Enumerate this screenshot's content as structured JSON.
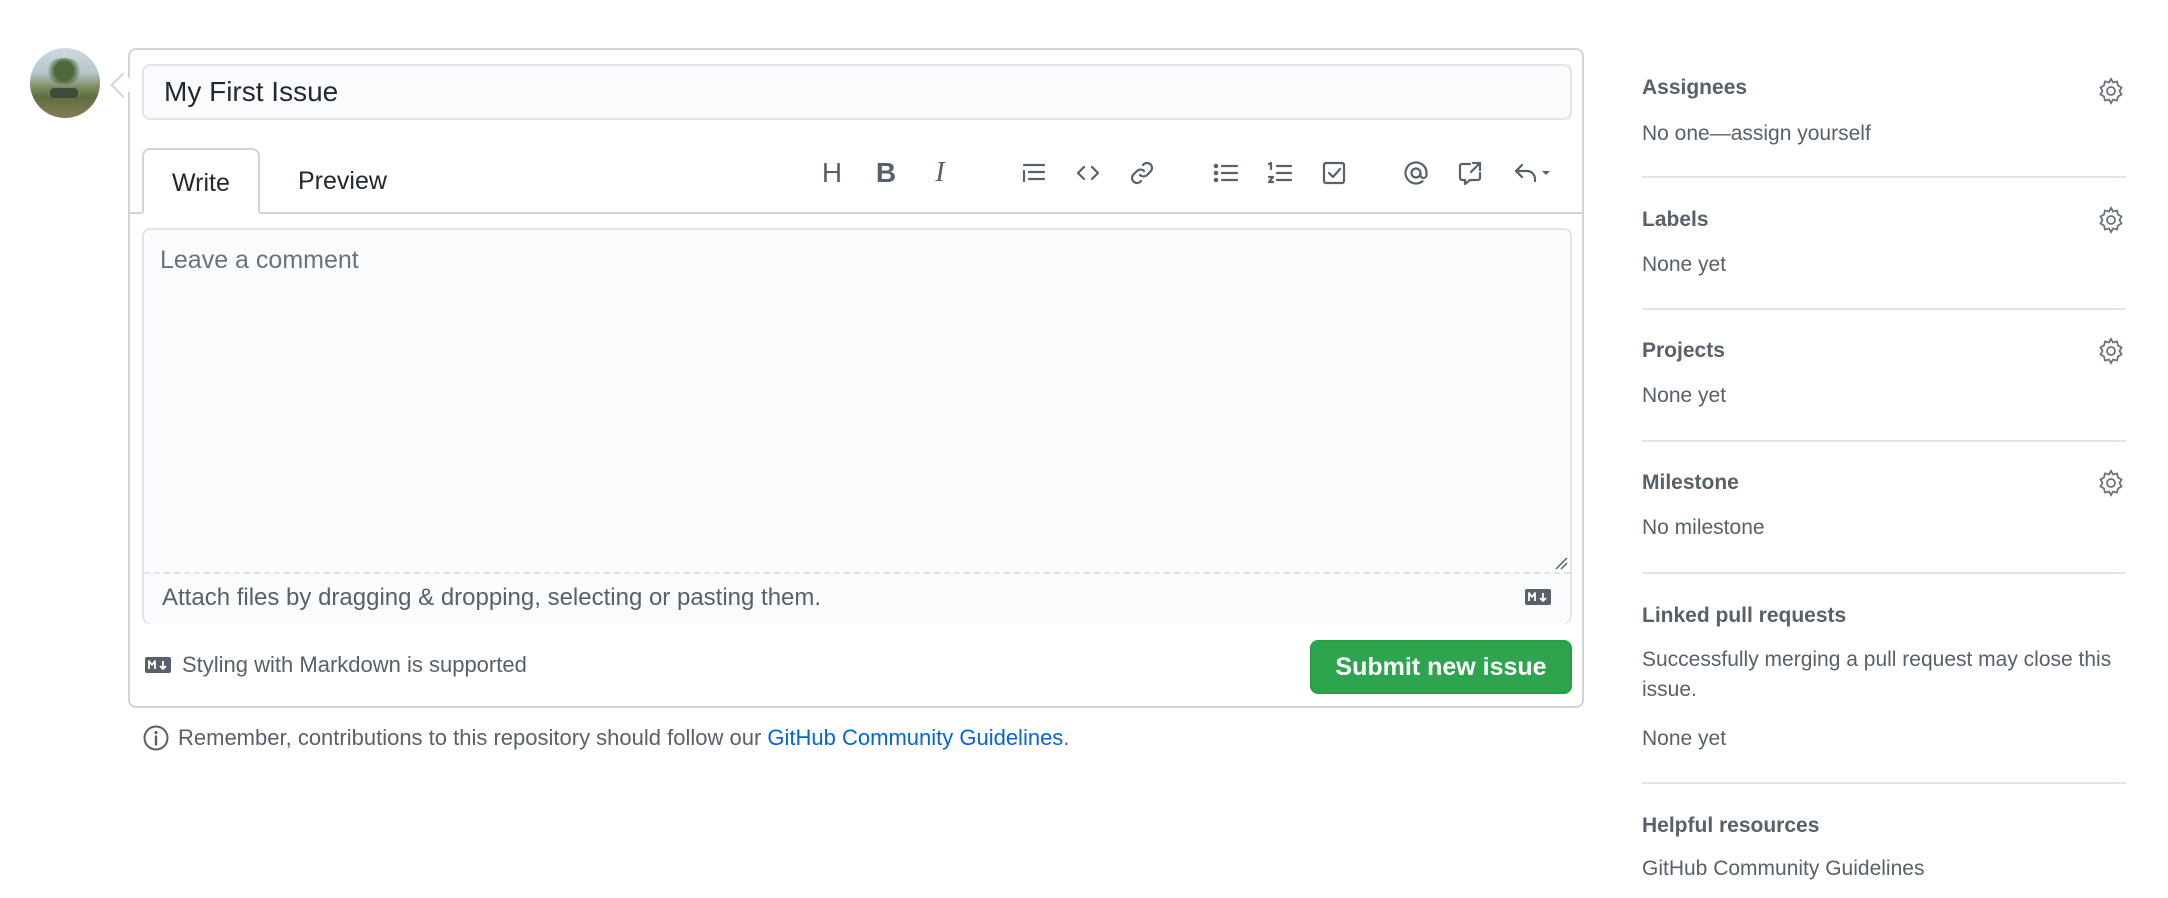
{
  "issue": {
    "title_value": "My First Issue",
    "tabs": {
      "write": "Write",
      "preview": "Preview"
    },
    "toolbar": {
      "heading": "H",
      "bold": "B",
      "italic": "I"
    },
    "comment_placeholder": "Leave a comment",
    "attach_text": "Attach files by dragging & dropping, selecting or pasting them.",
    "markdown_note": "Styling with Markdown is supported",
    "submit_label": "Submit new issue",
    "reminder_prefix": "Remember, contributions to this repository should follow our",
    "reminder_link": "GitHub Community Guidelines",
    "reminder_suffix": "."
  },
  "sidebar": {
    "assignees": {
      "heading": "Assignees",
      "value": "No one—assign yourself"
    },
    "labels": {
      "heading": "Labels",
      "value": "None yet"
    },
    "projects": {
      "heading": "Projects",
      "value": "None yet"
    },
    "milestone": {
      "heading": "Milestone",
      "value": "No milestone"
    },
    "linked_prs": {
      "heading": "Linked pull requests",
      "description": "Successfully merging a pull request may close this issue.",
      "value": "None yet"
    },
    "resources": {
      "heading": "Helpful resources",
      "link": "GitHub Community Guidelines"
    }
  },
  "colors": {
    "primary_button": "#2ea44f",
    "link": "#0366d6",
    "border": "#d1d5da",
    "muted_text": "#586069"
  }
}
